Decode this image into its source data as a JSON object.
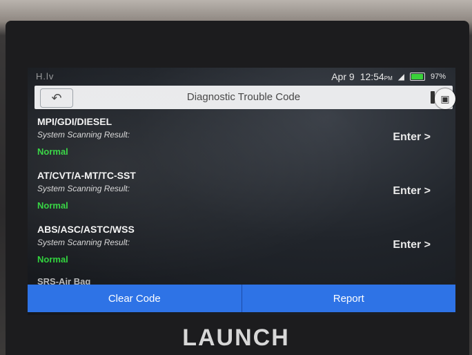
{
  "statusbar": {
    "left_text": "H.lv",
    "date": "Apr 9",
    "time": "12:54",
    "ampm": "PM",
    "battery": "97%",
    "battery_fraction": 0.97,
    "battery_color": "#3ad13a"
  },
  "appbar": {
    "back_icon": "back-arrow-icon",
    "title": "Diagnostic Trouble Code",
    "camera_icon": "camera-icon"
  },
  "systems": [
    {
      "name": "MPI/GDI/DIESEL",
      "subtitle": "System Scanning Result:",
      "status": "Normal",
      "action": "Enter >"
    },
    {
      "name": "AT/CVT/A-MT/TC-SST",
      "subtitle": "System Scanning Result:",
      "status": "Normal",
      "action": "Enter >"
    },
    {
      "name": "ABS/ASC/ASTC/WSS",
      "subtitle": "System Scanning Result:",
      "status": "Normal",
      "action": "Enter >"
    }
  ],
  "partial_item": "SRS-Air Bag",
  "bottom": {
    "clear": "Clear Code",
    "report": "Report"
  },
  "device": {
    "brand": "LAUNCH"
  },
  "colors": {
    "accent": "#2e73e6",
    "status_ok": "#2fd33c"
  }
}
